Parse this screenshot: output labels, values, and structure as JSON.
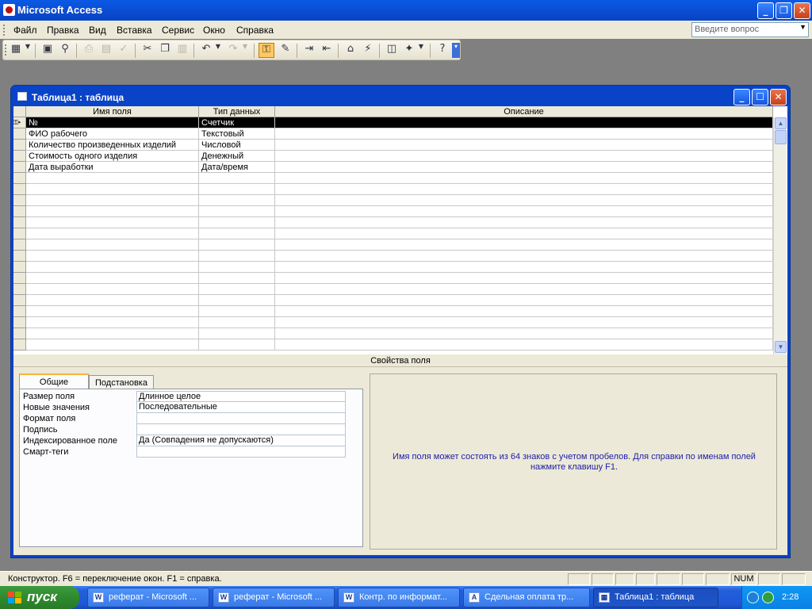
{
  "app": {
    "title": "Microsoft Access"
  },
  "window_controls": {
    "minimize": "_",
    "restore": "❐",
    "close": "✕"
  },
  "menu": [
    "Файл",
    "Правка",
    "Вид",
    "Вставка",
    "Сервис",
    "Окно",
    "Справка"
  ],
  "ask_box": {
    "placeholder": "Введите вопрос"
  },
  "toolbar_icons": [
    "view-icon",
    "save-icon",
    "search-icon",
    "print-icon",
    "print-preview-icon",
    "spelling-icon",
    "cut-icon",
    "copy-icon",
    "paste-icon",
    "undo-icon",
    "redo-icon",
    "primary-key-icon",
    "builder-icon",
    "insert-rows-icon",
    "delete-rows-icon",
    "properties-icon",
    "indexes-icon",
    "database-window-icon",
    "new-object-icon",
    "help-icon"
  ],
  "document": {
    "title": "Таблица1 : таблица",
    "columns": [
      "Имя поля",
      "Тип данных",
      "Описание"
    ],
    "rows": [
      {
        "name": "№",
        "type": "Счетчик",
        "desc": ""
      },
      {
        "name": "ФИО рабочего",
        "type": "Текстовый",
        "desc": ""
      },
      {
        "name": "Количество произведенных изделий",
        "type": "Числовой",
        "desc": ""
      },
      {
        "name": "Стоимость одного изделия",
        "type": "Денежный",
        "desc": ""
      },
      {
        "name": "Дата выработки",
        "type": "Дата/время",
        "desc": ""
      }
    ],
    "empty_rows": 16
  },
  "properties": {
    "section_label": "Свойства поля",
    "tabs": [
      "Общие",
      "Подстановка"
    ],
    "active_tab": 0,
    "fields": [
      {
        "label": "Размер поля",
        "value": "Длинное целое"
      },
      {
        "label": "Новые значения",
        "value": "Последовательные"
      },
      {
        "label": "Формат поля",
        "value": ""
      },
      {
        "label": "Подпись",
        "value": ""
      },
      {
        "label": "Индексированное поле",
        "value": "Да (Совпадения не допускаются)"
      },
      {
        "label": "Смарт-теги",
        "value": ""
      }
    ],
    "help_line1": "Имя поля может состоять из 64 знаков с учетом пробелов.  Для справки по именам полей",
    "help_line2": "нажмите клавишу F1."
  },
  "status": {
    "text": "Конструктор.  F6 = переключение окон.  F1 = справка.",
    "num": "NUM"
  },
  "taskbar": {
    "start_label": "пуск",
    "buttons": [
      {
        "label": "реферат - Microsoft ...",
        "icon": "W",
        "active": false
      },
      {
        "label": "реферат - Microsoft ...",
        "icon": "W",
        "active": false
      },
      {
        "label": "Контр. по информат...",
        "icon": "W",
        "active": false
      },
      {
        "label": "Сдельная оплата тр...",
        "icon": "A",
        "active": false
      },
      {
        "label": "Таблица1 : таблица",
        "icon": "▦",
        "active": true
      }
    ],
    "clock": "2:28"
  },
  "colors": {
    "title_bar": "#0a5ae6",
    "selected_row": "#000000",
    "help_text": "#1d1da8",
    "start_green": "#2f8a2f"
  }
}
